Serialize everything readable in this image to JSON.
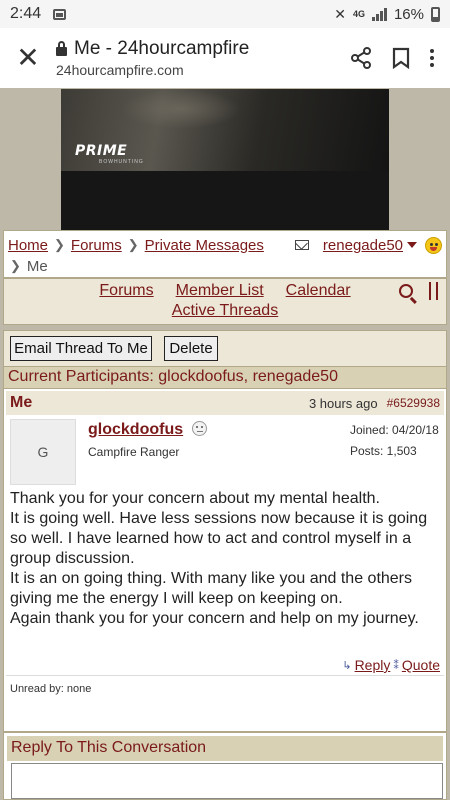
{
  "status": {
    "time": "2:44",
    "battery": "16%",
    "network": "4G"
  },
  "browser": {
    "title": "Me - 24hourcampfire",
    "url": "24hourcampfire.com"
  },
  "banner": {
    "logo": "PRIME",
    "logo_sub": "BOWHUNTING"
  },
  "breadcrumb": {
    "home": "Home",
    "forums": "Forums",
    "private": "Private Messages",
    "current": "Me",
    "user": "renegade50"
  },
  "nav": {
    "forums": "Forums",
    "members": "Member List",
    "calendar": "Calendar",
    "active": "Active Threads"
  },
  "thread": {
    "email_button": "Email Thread To Me",
    "delete_button": "Delete",
    "participants": "Current Participants: glockdoofus, renegade50"
  },
  "post": {
    "subject": "Me",
    "time": "3 hours ago",
    "number": "#6529938",
    "avatar_initial": "G",
    "username": "glockdoofus",
    "rank": "Campfire Ranger",
    "joined": "Joined: 04/20/18",
    "posts": "Posts: 1,503",
    "lines": [
      "Thank you for your concern about my mental health.",
      "It is going well. Have less sessions now because it is going so well. I have learned how to act and control myself in a group discussion.",
      "It is an on going thing. With many like you and the others giving me the energy I will keep on keeping on.",
      "Again thank you for your concern and help on my journey."
    ],
    "reply_label": "Reply",
    "quote_label": "Quote",
    "unread": "Unread by: none"
  },
  "reply_section": {
    "heading": "Reply To This Conversation"
  }
}
